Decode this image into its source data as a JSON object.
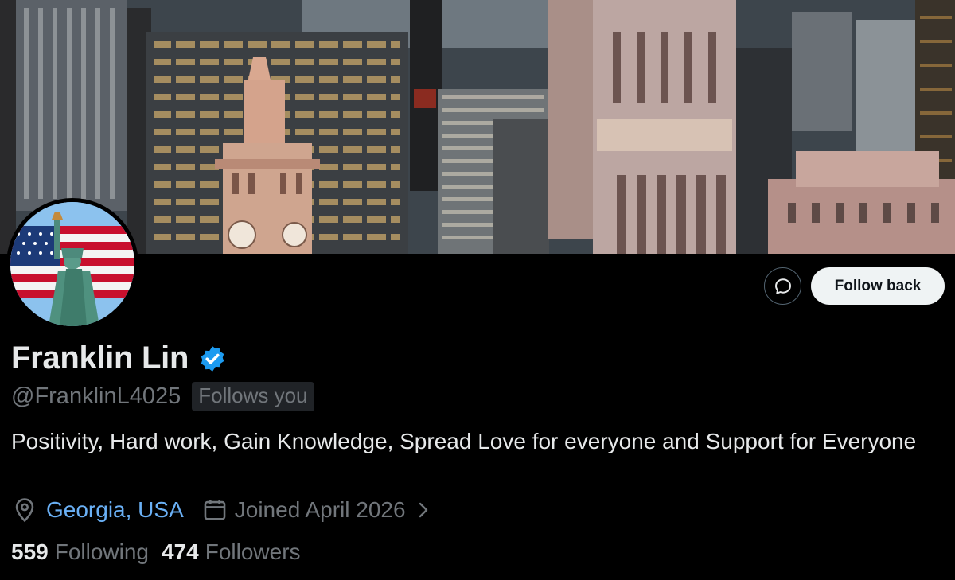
{
  "profile": {
    "display_name": "Franklin Lin",
    "handle": "@FranklinL4025",
    "follows_you_badge": "Follows you",
    "bio": "Positivity, Hard work, Gain Knowledge, Spread Love for everyone and Support for Everyone",
    "location": "Georgia, USA",
    "joined": "Joined April 2026",
    "following_count": "559",
    "following_label": "Following",
    "followers_count": "474",
    "followers_label": "Followers"
  },
  "actions": {
    "follow_back_label": "Follow back"
  },
  "icons": {
    "message": "message-icon",
    "verified": "verified-badge-icon",
    "location": "location-pin-icon",
    "calendar": "calendar-icon",
    "chevron": "chevron-right-icon"
  },
  "colors": {
    "background": "#000000",
    "primary_text": "#e7e9ea",
    "secondary_text": "#71767b",
    "link": "#6ab0f5",
    "verified": "#1d9bf0",
    "button_bg": "#eff3f4"
  },
  "images": {
    "banner": "city skyline header",
    "avatar": "american flag and statue of liberty"
  }
}
